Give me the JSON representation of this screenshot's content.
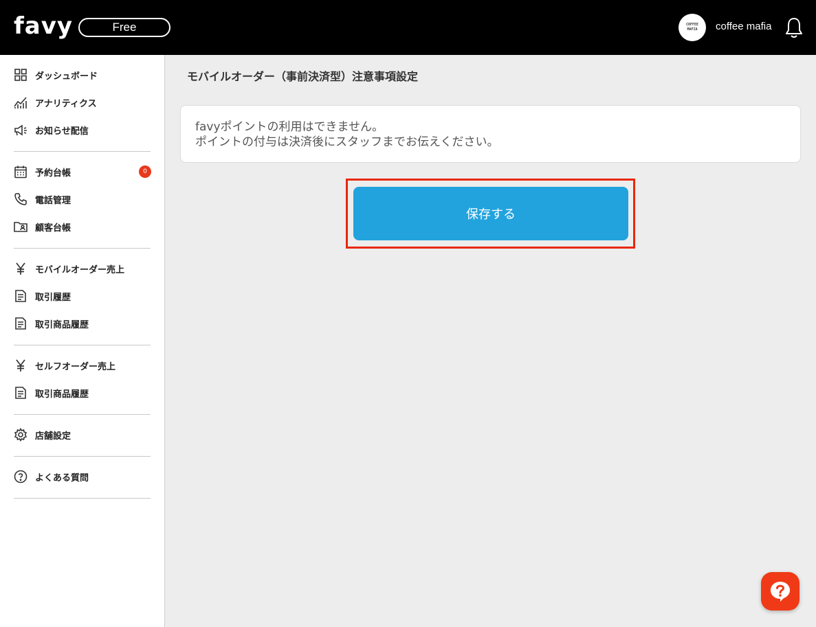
{
  "header": {
    "logo": "favy",
    "plan": "Free",
    "avatar_lines": [
      "COFFEE",
      "MAFIA"
    ],
    "store_name": "coffee mafia"
  },
  "sidebar": {
    "items": [
      {
        "label": "ダッシュボード",
        "icon": "dashboard-icon"
      },
      {
        "label": "アナリティクス",
        "icon": "analytics-icon"
      },
      {
        "label": "お知らせ配信",
        "icon": "megaphone-icon"
      },
      {
        "label": "予約台帳",
        "icon": "calendar-icon",
        "badge": "0"
      },
      {
        "label": "電話管理",
        "icon": "phone-icon"
      },
      {
        "label": "顧客台帳",
        "icon": "customer-folder-icon"
      },
      {
        "label": "モバイルオーダー売上",
        "icon": "yen-icon"
      },
      {
        "label": "取引履歴",
        "icon": "document-icon"
      },
      {
        "label": "取引商品履歴",
        "icon": "document-icon"
      },
      {
        "label": "セルフオーダー売上",
        "icon": "yen-icon"
      },
      {
        "label": "取引商品履歴",
        "icon": "document-icon"
      },
      {
        "label": "店舗設定",
        "icon": "gear-icon"
      },
      {
        "label": "よくある質問",
        "icon": "question-icon"
      }
    ]
  },
  "main": {
    "title": "モバイルオーダー（事前決済型）注意事項設定",
    "notice_lines": [
      "favyポイントの利用はできません。",
      "ポイントの付与は決済後にスタッフまでお伝えください。"
    ],
    "save_label": "保存する"
  },
  "colors": {
    "accent": "#22a3dd",
    "highlight": "#e8280c",
    "badge": "#e8391d",
    "help": "#f03a17"
  }
}
